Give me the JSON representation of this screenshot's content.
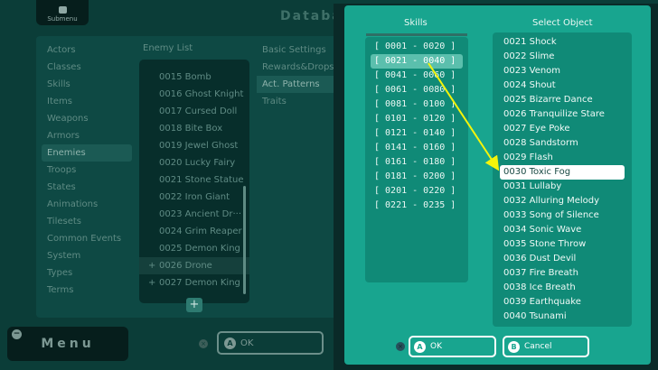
{
  "background": {
    "submenu_label": "Submenu",
    "title": "Databas",
    "categories": [
      "Actors",
      "Classes",
      "Skills",
      "Items",
      "Weapons",
      "Armors",
      "Enemies",
      "Troops",
      "States",
      "Animations",
      "Tilesets",
      "Common Events",
      "System",
      "Types",
      "Terms"
    ],
    "active_category": "Enemies",
    "enemy_list_header": "Enemy List",
    "enemies": [
      {
        "label": "0015 Bomb",
        "plus": ""
      },
      {
        "label": "0016 Ghost Knight",
        "plus": ""
      },
      {
        "label": "0017 Cursed Doll",
        "plus": ""
      },
      {
        "label": "0018 Bite Box",
        "plus": ""
      },
      {
        "label": "0019 Jewel Ghost",
        "plus": ""
      },
      {
        "label": "0020 Lucky Fairy",
        "plus": ""
      },
      {
        "label": "0021 Stone Statue",
        "plus": ""
      },
      {
        "label": "0022 Iron Giant",
        "plus": ""
      },
      {
        "label": "0023 Ancient Dr···",
        "plus": ""
      },
      {
        "label": "0024 Grim Reaper",
        "plus": ""
      },
      {
        "label": "0025 Demon King",
        "plus": ""
      },
      {
        "label": "0026 Drone",
        "plus": "+"
      },
      {
        "label": "0027 Demon King",
        "plus": "+"
      }
    ],
    "add_label": "+",
    "tabs": [
      "Basic Settings",
      "Rewards&Drops",
      "Act. Patterns",
      "Traits"
    ],
    "active_tab": "Act. Patterns",
    "menu_label": "Menu",
    "menu_minus": "−",
    "ok_x": "×",
    "ok_circle": "A",
    "ok_label": "OK"
  },
  "dialog": {
    "skills_title": "Skills",
    "select_title": "Select Object",
    "skill_ranges": [
      "[ 0001 - 0020 ]",
      "[ 0021 - 0040 ]",
      "[ 0041 - 0060 ]",
      "[ 0061 - 0080 ]",
      "[ 0081 - 0100 ]",
      "[ 0101 - 0120 ]",
      "[ 0121 - 0140 ]",
      "[ 0141 - 0160 ]",
      "[ 0161 - 0180 ]",
      "[ 0181 - 0200 ]",
      "[ 0201 - 0220 ]",
      "[ 0221 - 0235 ]"
    ],
    "selected_range": "[ 0021 - 0040 ]",
    "objects": [
      "0021 Shock",
      "0022 Slime",
      "0023 Venom",
      "0024 Shout",
      "0025 Bizarre Dance",
      "0026 Tranquilize Stare",
      "0027 Eye Poke",
      "0028 Sandstorm",
      "0029 Flash",
      "0030 Toxic Fog",
      "0031 Lullaby",
      "0032 Alluring Melody",
      "0033 Song of Silence",
      "0034 Sonic Wave",
      "0035 Stone Throw",
      "0036 Dust Devil",
      "0037 Fire Breath",
      "0038 Ice Breath",
      "0039 Earthquake",
      "0040 Tsunami"
    ],
    "selected_object": "0030 Toxic Fog",
    "close_x": "×",
    "ok_circle": "A",
    "ok_label": "OK",
    "cancel_circle": "B",
    "cancel_label": "Cancel",
    "arrow_color": "#f4f40a"
  }
}
